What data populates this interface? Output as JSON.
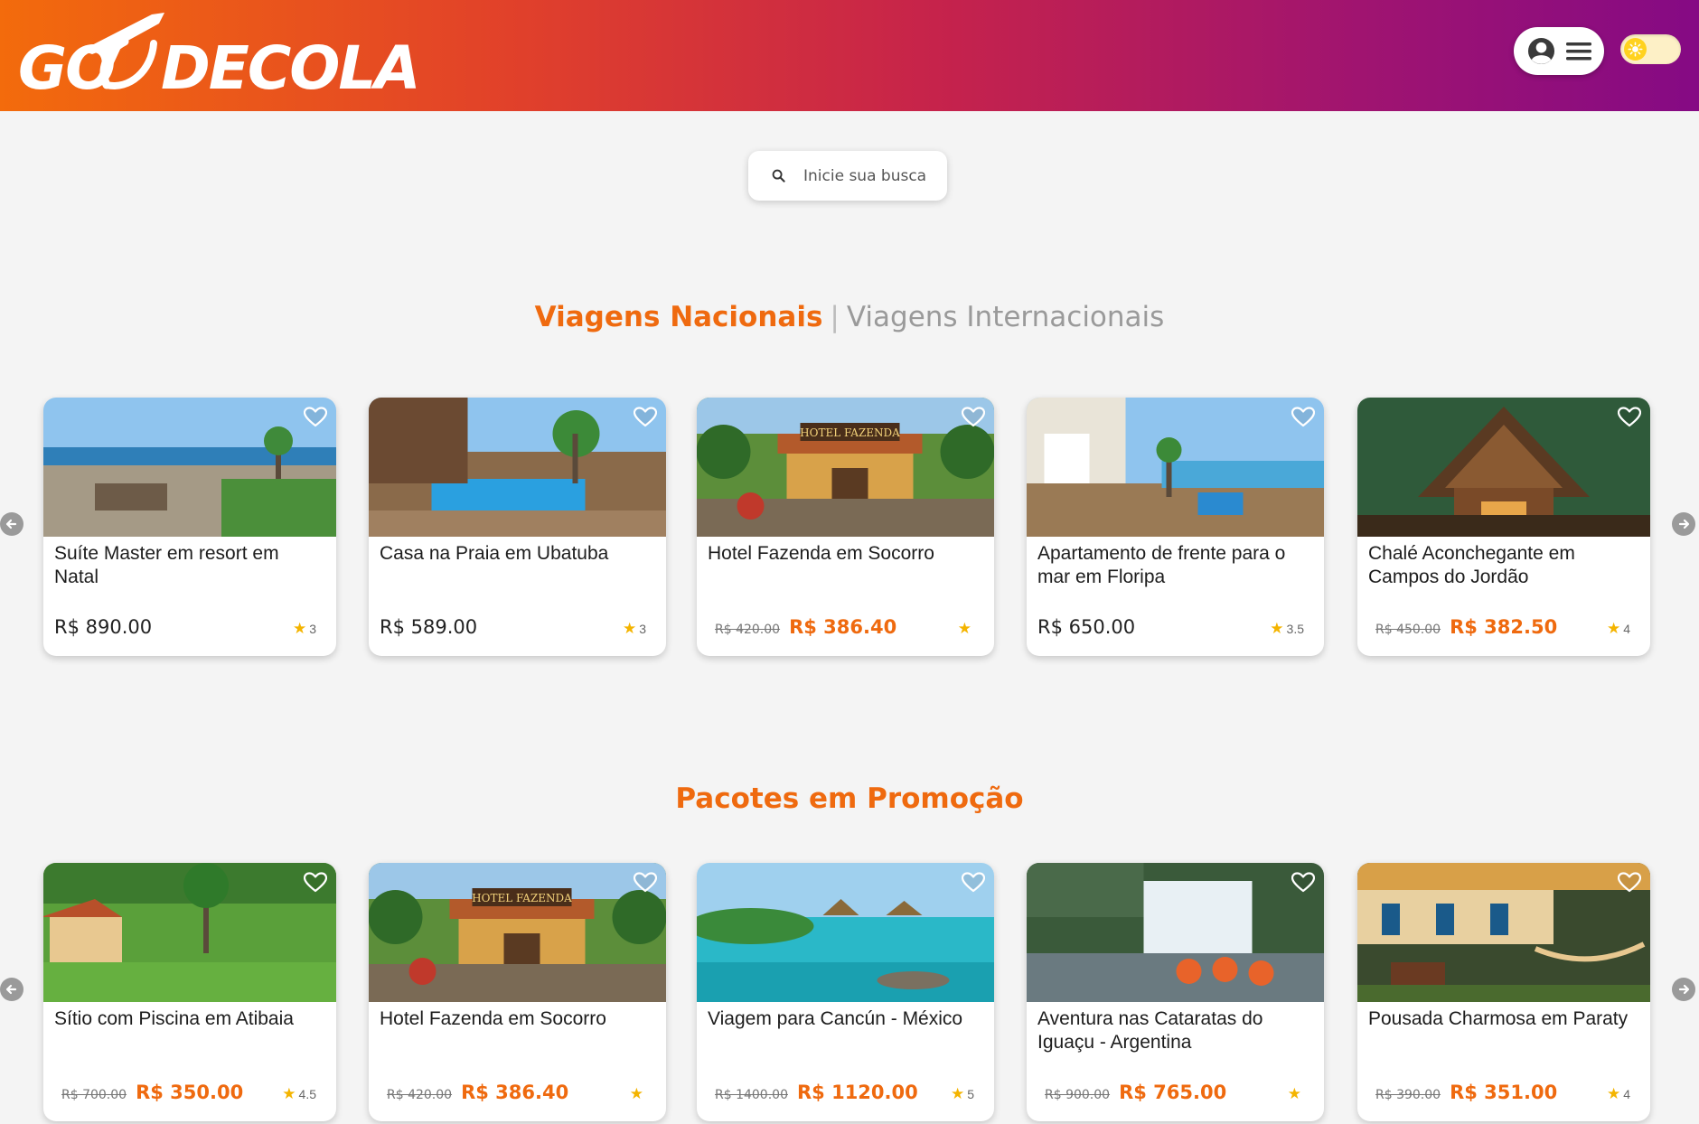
{
  "brand": {
    "name": "GO DECOLA"
  },
  "header": {
    "profile_icon": "user-circle-icon",
    "menu_icon": "hamburger-icon",
    "theme_icon": "sun-icon"
  },
  "search": {
    "placeholder": "Inicie sua busca",
    "icon": "search-icon"
  },
  "sections": {
    "tab_national": "Viagens Nacionais",
    "separator": "|",
    "tab_international": "Viagens Internacionais",
    "promo_title": "Pacotes em Promoção"
  },
  "colors": {
    "accent": "#ef6a0f",
    "header_start": "#f36b0c",
    "header_end": "#850a84",
    "star": "#f4b400"
  },
  "national": [
    {
      "title": "Suíte Master em resort em Natal",
      "old_price": "",
      "price": "R$ 890.00",
      "rating": "3",
      "theme": "resort"
    },
    {
      "title": "Casa na Praia em Ubatuba",
      "old_price": "",
      "price": "R$ 589.00",
      "rating": "3",
      "theme": "pool"
    },
    {
      "title": "Hotel Fazenda em Socorro",
      "old_price": "R$ 420.00",
      "price": "R$ 386.40",
      "rating": "",
      "theme": "fazenda"
    },
    {
      "title": "Apartamento de frente para o mar em Floripa",
      "old_price": "",
      "price": "R$ 650.00",
      "rating": "3.5",
      "theme": "apartment"
    },
    {
      "title": "Chalé Aconchegante em Campos do Jordão",
      "old_price": "R$ 450.00",
      "price": "R$ 382.50",
      "rating": "4",
      "theme": "chalet"
    }
  ],
  "promos": [
    {
      "title": "Sítio com Piscina em Atibaia",
      "old_price": "R$ 700.00",
      "price": "R$ 350.00",
      "rating": "4.5",
      "theme": "garden"
    },
    {
      "title": "Hotel Fazenda em Socorro",
      "old_price": "R$ 420.00",
      "price": "R$ 386.40",
      "rating": "",
      "theme": "fazenda"
    },
    {
      "title": "Viagem para Cancún - México",
      "old_price": "R$ 1400.00",
      "price": "R$ 1120.00",
      "rating": "5",
      "theme": "cancun"
    },
    {
      "title": "Aventura nas Cataratas do Iguaçu - Argentina",
      "old_price": "R$ 900.00",
      "price": "R$ 765.00",
      "rating": "",
      "theme": "falls"
    },
    {
      "title": "Pousada Charmosa em Paraty",
      "old_price": "R$ 390.00",
      "price": "R$ 351.00",
      "rating": "4",
      "theme": "pousada"
    }
  ],
  "image_labels": {
    "fazenda_sign": "HOTEL FAZENDA"
  }
}
